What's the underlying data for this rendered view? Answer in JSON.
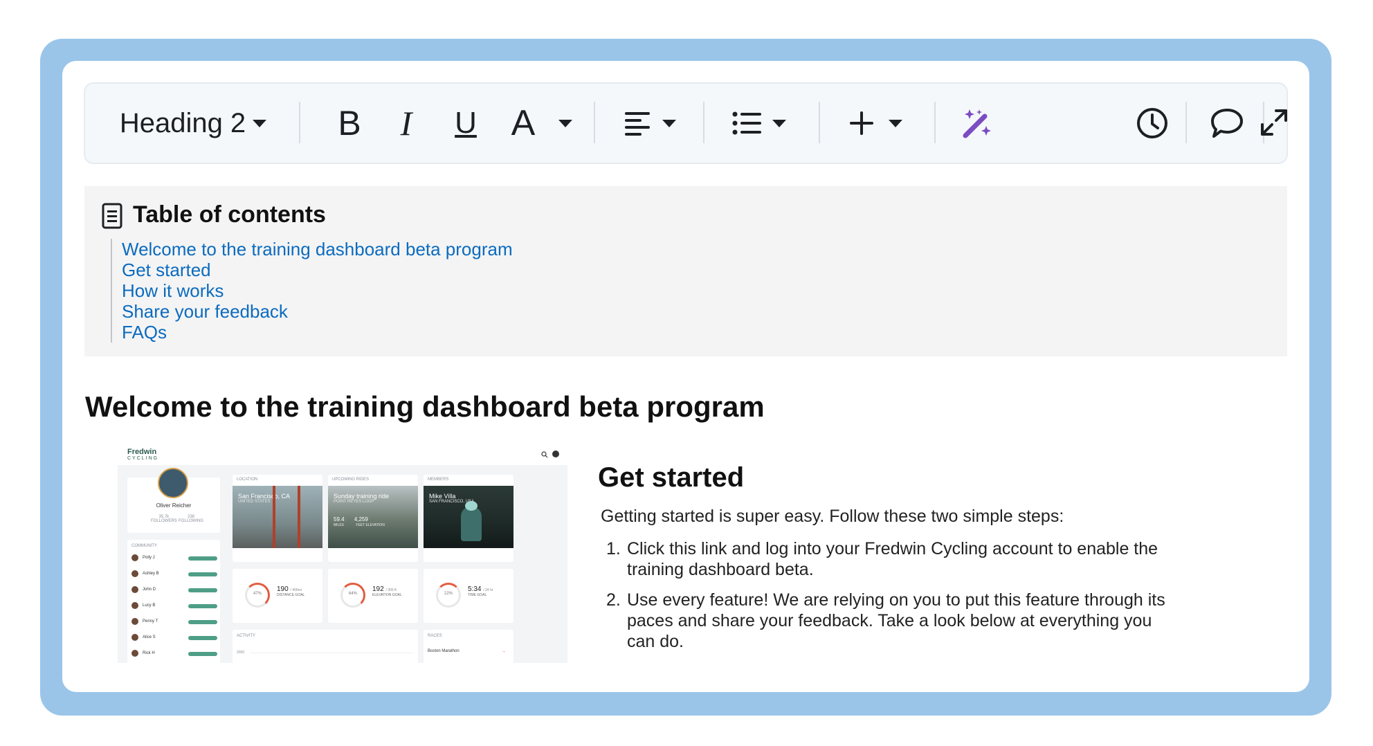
{
  "toolbar": {
    "style_label": "Heading 2",
    "bold_glyph": "B",
    "italic_glyph": "I",
    "underline_glyph": "U",
    "text_color_glyph": "A",
    "ai_icon_color": "#7b4cc2"
  },
  "toc": {
    "title": "Table of contents",
    "items": [
      "Welcome to the training dashboard beta program",
      "Get started",
      "How it works",
      "Share your feedback",
      "FAQs"
    ]
  },
  "content": {
    "heading1": "Welcome to the training dashboard beta program",
    "heading2": "Get started",
    "intro": "Getting started is super easy. Follow these two simple steps:",
    "steps": [
      {
        "num": "1.",
        "text": "Click this link and log into your Fredwin Cycling account to enable the training dashboard beta."
      },
      {
        "num": "2.",
        "text": "Use every feature! We are relying on you to put this feature through its paces and share your feedback. Take a look below at everything you can do."
      }
    ]
  },
  "screenshot": {
    "brand": "Fredwin",
    "brand_sub": "CYCLING",
    "profile_name": "Oliver Reicher",
    "followers_value": "35.7k",
    "followers_label": "FOLLOWERS",
    "following_value": "238",
    "following_label": "FOLLOWING",
    "community_label": "COMMUNITY",
    "community": [
      "Polly J",
      "Ashley B",
      "John D",
      "Lucy B",
      "Penny T",
      "Alice S",
      "Rick H"
    ],
    "cards": [
      {
        "label": "LOCATION",
        "title": "San Francisco, CA",
        "sub": "UNITED STATES"
      },
      {
        "label": "UPCOMING RIDES",
        "title": "Sunday training ride",
        "sub": "POINT REYES LOOP"
      },
      {
        "label": "MEMBERS",
        "title": "Mike Villa",
        "sub": "SAN FRANCISCO, USA"
      }
    ],
    "ride_stats": {
      "miles": "59.4",
      "miles_label": "MILES",
      "elev": "4,259",
      "elev_label": "FEET ELEVATION"
    },
    "goals": [
      {
        "pct": "47%",
        "value": "190",
        "unit": "/ 400mi",
        "label": "DISTANCE GOAL"
      },
      {
        "pct": "64%",
        "value": "192",
        "unit": "/ 300 ft",
        "label": "ELEVATION GOAL"
      },
      {
        "pct": "22%",
        "value": "5:34",
        "unit": "/ 24 hr",
        "label": "TIME GOAL"
      }
    ],
    "activity_label": "ACTIVITY",
    "activity_tick": "2000",
    "races_label": "RACES",
    "race_item": "Boston Marathon"
  }
}
